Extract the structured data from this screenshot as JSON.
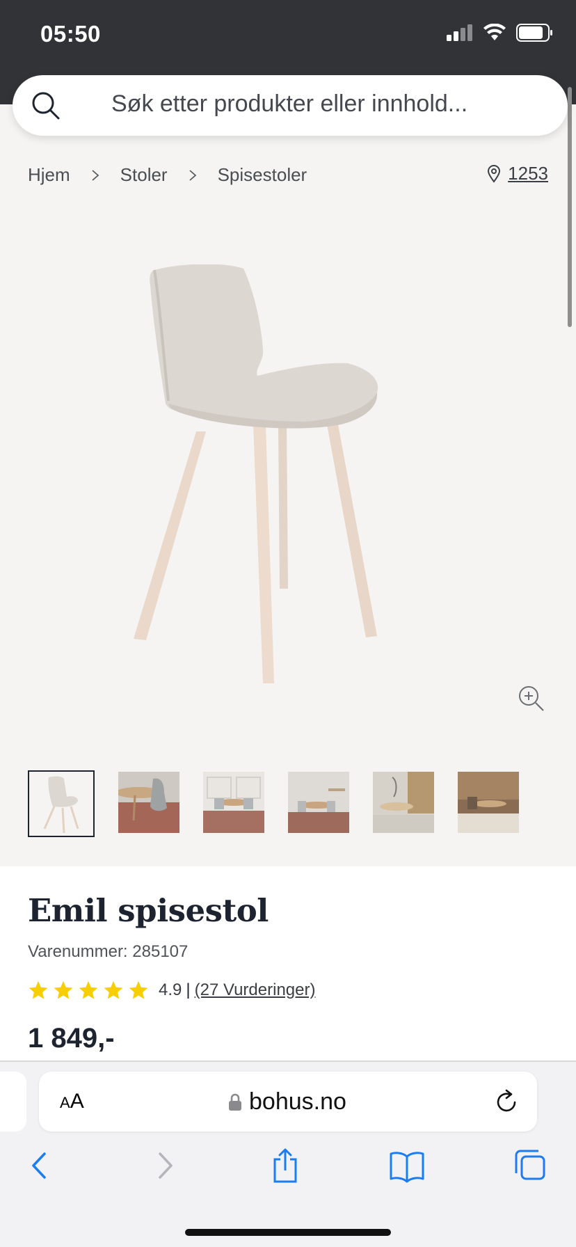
{
  "status": {
    "time": "05:50"
  },
  "search": {
    "placeholder": "Søk etter produkter eller innhold..."
  },
  "breadcrumb": {
    "items": [
      "Hjem",
      "Stoler",
      "Spisestoler"
    ]
  },
  "store": {
    "number": "1253"
  },
  "product": {
    "name": "Emil spisestol",
    "sku_label": "Varenummer: 285107",
    "rating_value": "4.9",
    "rating_sep": "|",
    "reviews_label": "(27 Vurderinger)",
    "stars": 5,
    "price": "1 849,-",
    "thumbnails": [
      "thumb-chair-studio",
      "thumb-room-1",
      "thumb-room-2",
      "thumb-room-3",
      "thumb-room-4",
      "thumb-room-5"
    ]
  },
  "browser": {
    "text_size_label": "AA",
    "url": "bohus.no"
  },
  "colors": {
    "dark_text": "#1d2430",
    "star": "#f7ce00",
    "status_bar": "#323337",
    "ios_blue": "#1c7cf2"
  }
}
